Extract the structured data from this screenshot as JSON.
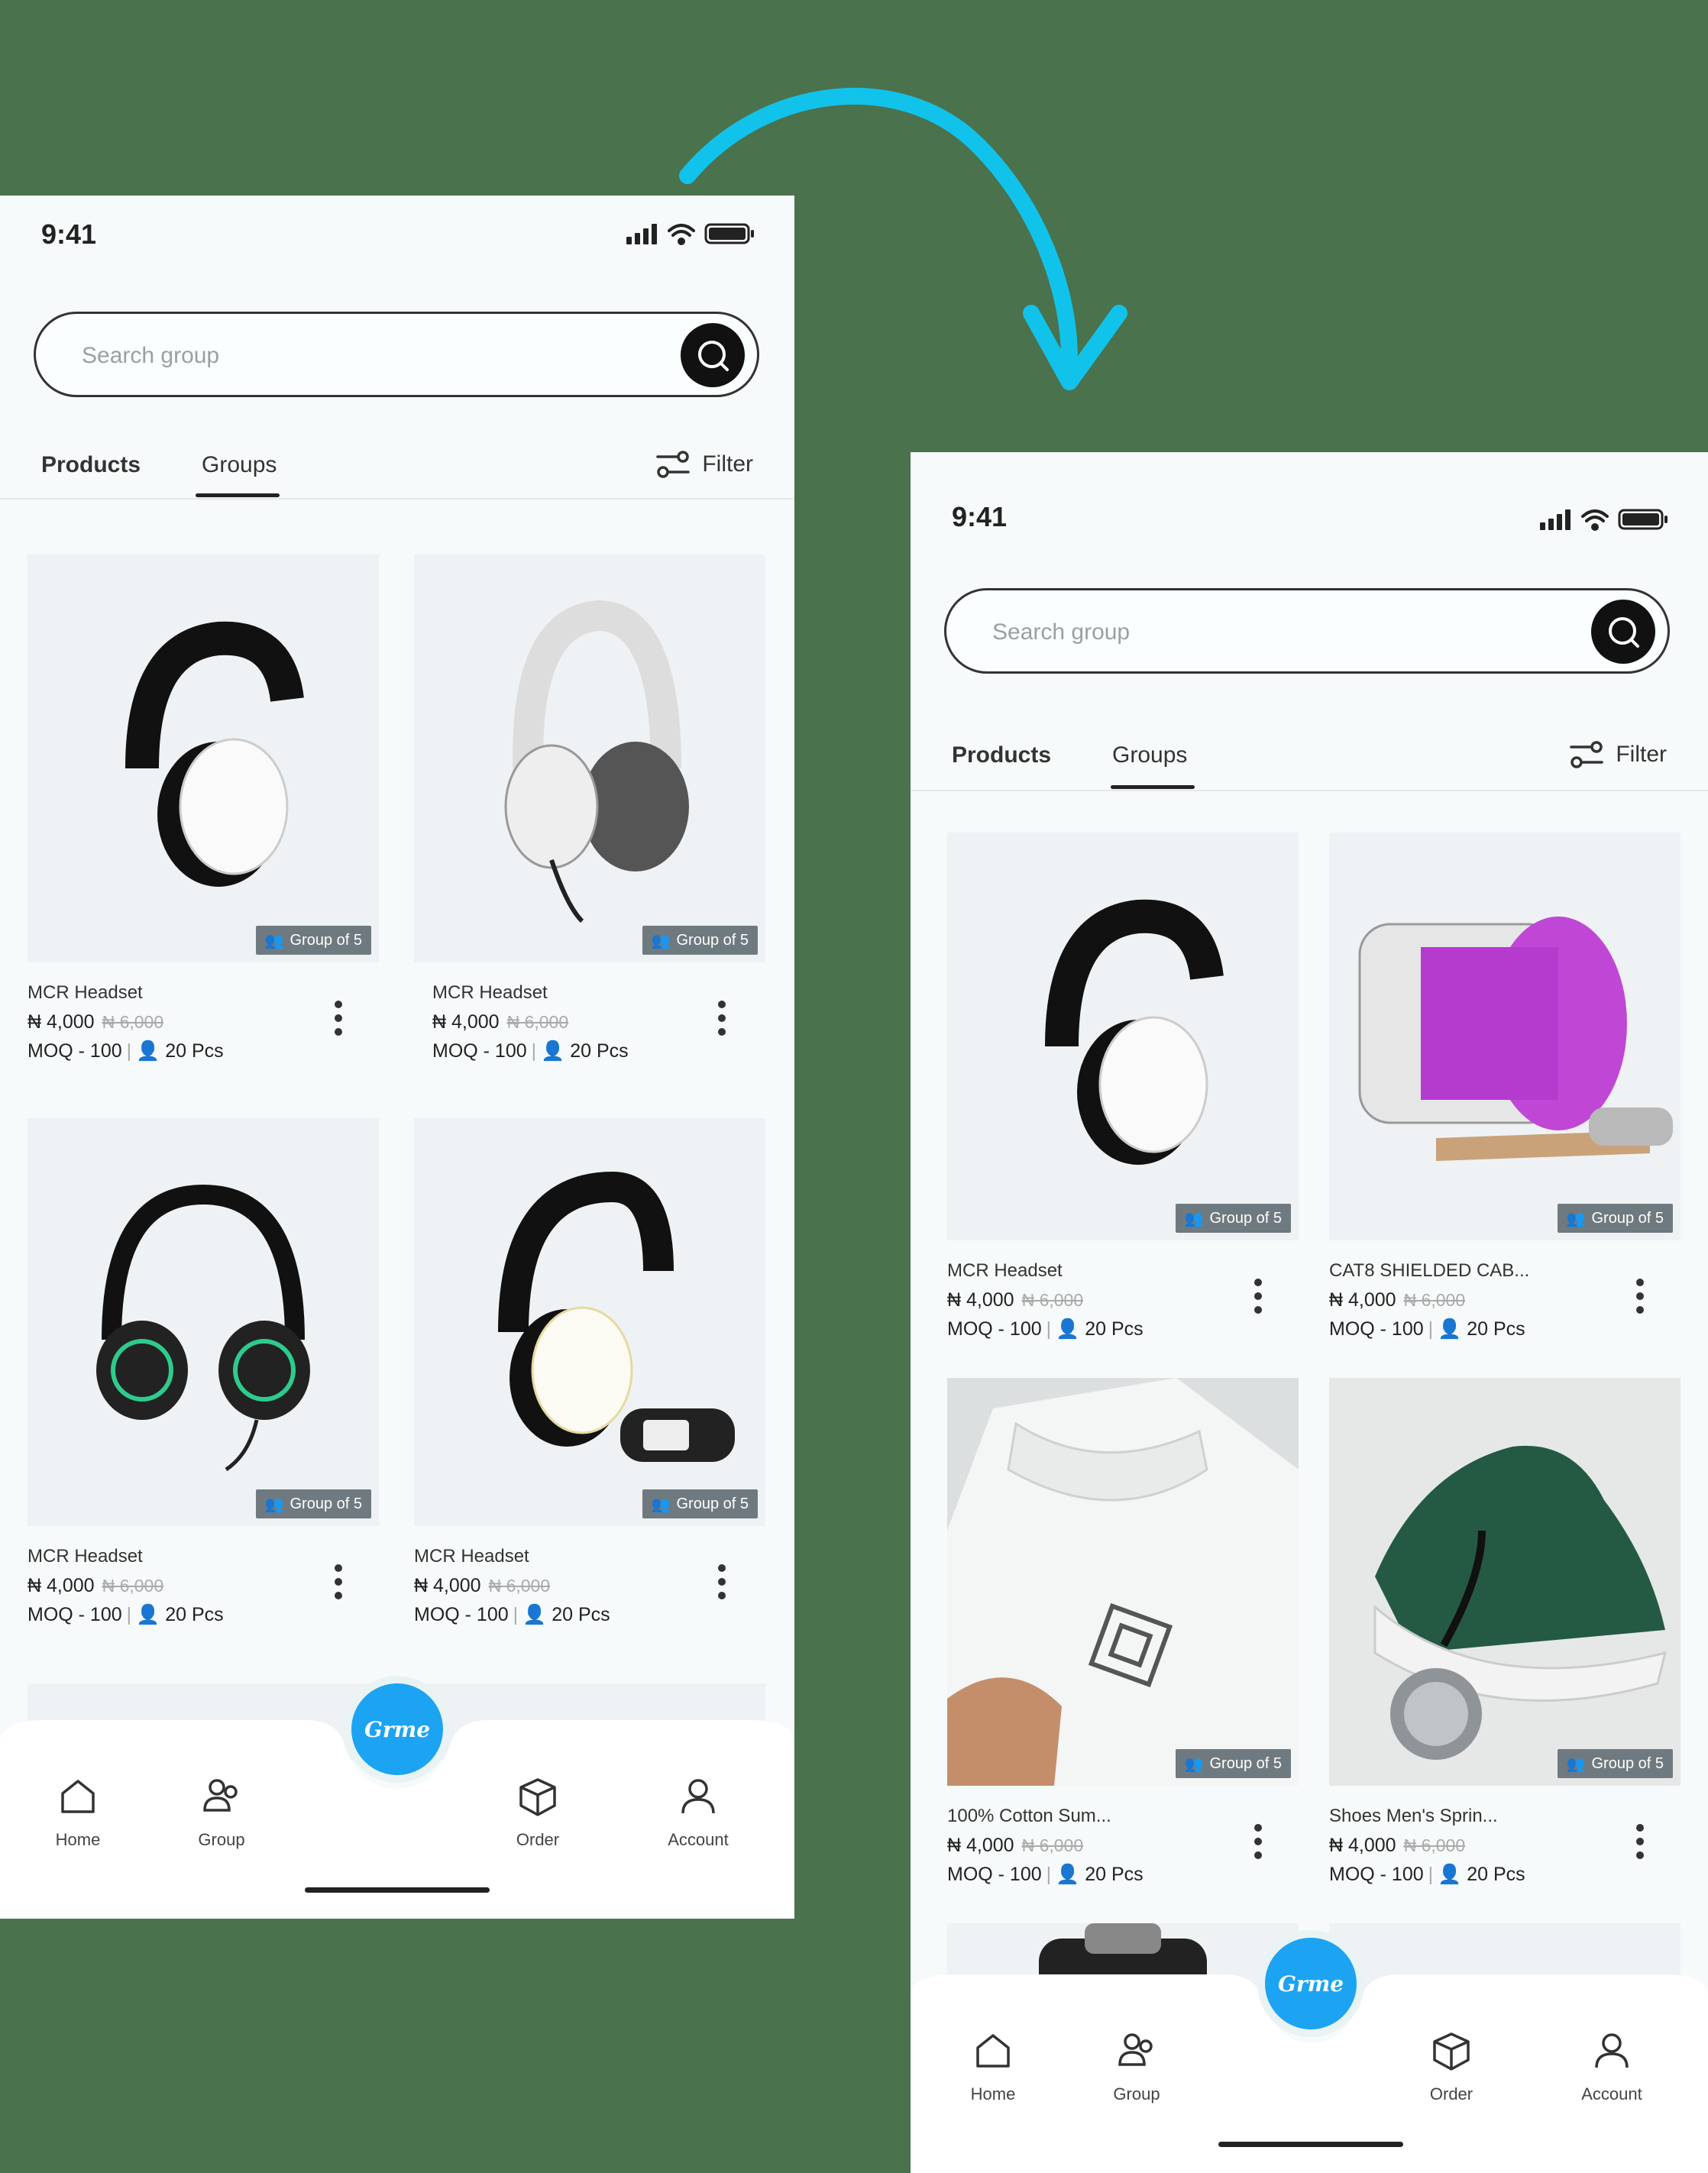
{
  "colors": {
    "background": "#4a724d",
    "screen": "#f7fafa",
    "accent": "#1ca4f2",
    "arrow": "#11c3ea"
  },
  "screens": [
    {
      "status": {
        "time": "9:41"
      },
      "search": {
        "placeholder": "Search group",
        "icon": "search-icon"
      },
      "tabs": [
        "Products",
        "Groups"
      ],
      "filter_label": "Filter",
      "products": [
        {
          "name": "MCR Headset",
          "price": "₦ 4,000",
          "old_price": "₦ 6,000",
          "moq": "MOQ - 100",
          "pcs": "20 Pcs",
          "badge": "Group of 5"
        },
        {
          "name": "MCR Headset",
          "price": "₦ 4,000",
          "old_price": "₦ 6,000",
          "moq": "MOQ - 100",
          "pcs": "20 Pcs",
          "badge": "Group of 5"
        },
        {
          "name": "MCR Headset",
          "price": "₦ 4,000",
          "old_price": "₦ 6,000",
          "moq": "MOQ - 100",
          "pcs": "20 Pcs",
          "badge": "Group of 5"
        },
        {
          "name": "MCR Headset",
          "price": "₦ 4,000",
          "old_price": "₦ 6,000",
          "moq": "MOQ - 100",
          "pcs": "20 Pcs",
          "badge": "Group of 5"
        }
      ],
      "nav": {
        "home": "Home",
        "group": "Group",
        "order": "Order",
        "account": "Account",
        "fab_logo": "Grme"
      }
    },
    {
      "status": {
        "time": "9:41"
      },
      "search": {
        "placeholder": "Search group",
        "icon": "search-icon"
      },
      "tabs": [
        "Products",
        "Groups"
      ],
      "filter_label": "Filter",
      "products": [
        {
          "name": "MCR Headset",
          "price": "₦ 4,000",
          "old_price": "₦ 6,000",
          "moq": "MOQ - 100",
          "pcs": "20 Pcs",
          "badge": "Group of 5"
        },
        {
          "name": "CAT8 SHIELDED CAB...",
          "price": "₦ 4,000",
          "old_price": "₦ 6,000",
          "moq": "MOQ - 100",
          "pcs": "20 Pcs",
          "badge": "Group of 5"
        },
        {
          "name": "100% Cotton Sum...",
          "price": "₦ 4,000",
          "old_price": "₦ 6,000",
          "moq": "MOQ - 100",
          "pcs": "20 Pcs",
          "badge": "Group of 5"
        },
        {
          "name": "Shoes Men's Sprin...",
          "price": "₦ 4,000",
          "old_price": "₦ 6,000",
          "moq": "MOQ - 100",
          "pcs": "20 Pcs",
          "badge": "Group of 5"
        }
      ],
      "nav": {
        "home": "Home",
        "group": "Group",
        "order": "Order",
        "account": "Account",
        "fab_logo": "Grme"
      }
    }
  ]
}
